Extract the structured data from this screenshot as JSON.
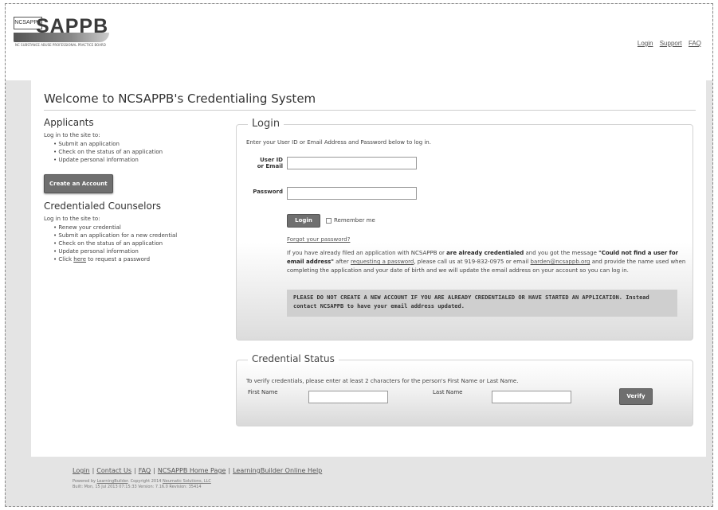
{
  "header": {
    "logo_badge": "NCSAPPB",
    "logo_text": "SAPPB",
    "logo_tagline": "NC SUBSTANCE ABUSE PROFESSIONAL PRACTICE BOARD",
    "links": [
      "Login",
      "Support",
      "FAQ"
    ]
  },
  "page": {
    "title": "Welcome to NCSAPPB's Credentialing System"
  },
  "applicants": {
    "heading": "Applicants",
    "intro": "Log in to the site to:",
    "items": [
      "Submit an application",
      "Check on the status of an application",
      "Update personal information"
    ],
    "create_button": "Create an Account"
  },
  "counselors": {
    "heading": "Credentialed Counselors",
    "intro": "Log in to the site to:",
    "items": [
      "Renew your credential",
      "Submit an application for a new credential",
      "Check on the status of an application",
      "Update personal information"
    ],
    "last_prefix": "Click ",
    "last_link": "here",
    "last_suffix": " to request a password"
  },
  "login": {
    "legend": "Login",
    "intro": "Enter your User ID or Email Address and Password below to log in.",
    "user_label_1": "User ID",
    "user_label_2": "or Email",
    "user_value": "",
    "password_label": "Password",
    "password_value": "",
    "login_button": "Login",
    "remember_label": "Remember me",
    "forgot_link": "Forgot your password?",
    "help_1": "If you have already filed an application with NCSAPPB or ",
    "help_bold_1": "are already credentialed",
    "help_2": " and you got the message ",
    "help_bold_2": "\"Could not find a user for email address\"",
    "help_3": " after ",
    "help_link_1": "requesting a password",
    "help_4": ", please call us at 919-832-0975 or email ",
    "help_link_2": "barden@ncsappb.org",
    "help_5": " and provide the name used when completing the application and your date of birth and we will update the email address on your account so you can log in.",
    "warning": "PLEASE DO NOT CREATE A NEW ACCOUNT IF YOU ARE ALREADY CREDENTIALED OR HAVE STARTED AN APPLICATION. Instead contact NCSAPPB to have your email address updated."
  },
  "credential": {
    "legend": "Credential Status",
    "intro": "To verify credentials, please enter at least 2 characters for the person's First Name or Last Name.",
    "first_label": "First Name",
    "first_value": "",
    "last_label": "Last Name",
    "last_value": "",
    "verify_button": "Verify"
  },
  "footer": {
    "links": [
      "Login",
      "Contact Us",
      "FAQ",
      "NCSAPPB Home Page",
      "LearningBuilder Online Help"
    ],
    "powered_prefix": "Powered by ",
    "powered_link": "LearningBuilder",
    "copyright": ". Copyright 2014 ",
    "company_link": "Neumatic Solutions, LLC",
    "build": "Built: Mon, 15 Jul 2013 07:15:33 Version: 7.16.0 Revision: 35414"
  }
}
